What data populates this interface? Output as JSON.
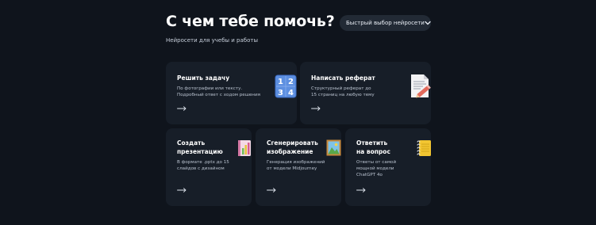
{
  "header": {
    "title": "С чем тебе помочь?",
    "subtitle": "Нейросети для учебы и работы",
    "picker_label": "Быстрый выбор нейросети"
  },
  "cards": [
    {
      "title_lines": [
        "Решить задачу"
      ],
      "desc_lines": [
        "По фотографии или тексту.",
        "Подробный ответ с ходом решения"
      ],
      "icon": "numbers-icon",
      "icon_text": [
        "1",
        "2",
        "3",
        "4"
      ]
    },
    {
      "title_lines": [
        "Написать реферат"
      ],
      "desc_lines": [
        "Структурный реферат до",
        "15 страниц на любую тему"
      ],
      "icon": "document-pencil-icon"
    },
    {
      "title_lines": [
        "Создать",
        "презентацию"
      ],
      "desc_lines": [
        "В формате .pptx до 15",
        "слайдов с дизайном"
      ],
      "icon": "presentation-notebook-icon"
    },
    {
      "title_lines": [
        "Сгенерировать",
        "изображение"
      ],
      "desc_lines": [
        "Генерация изображений",
        "от модели Midjourney"
      ],
      "icon": "framed-picture-icon"
    },
    {
      "title_lines": [
        "Ответить",
        "на вопрос"
      ],
      "desc_lines": [
        "Ответы от самой",
        "мощной модели",
        "ChatGPT 4o"
      ],
      "icon": "spiral-notepad-icon"
    }
  ],
  "colors": {
    "background": "#0f141c",
    "card": "#171e28",
    "picker": "#222a35",
    "text": "#ffffff",
    "muted": "#b9c2cf"
  }
}
